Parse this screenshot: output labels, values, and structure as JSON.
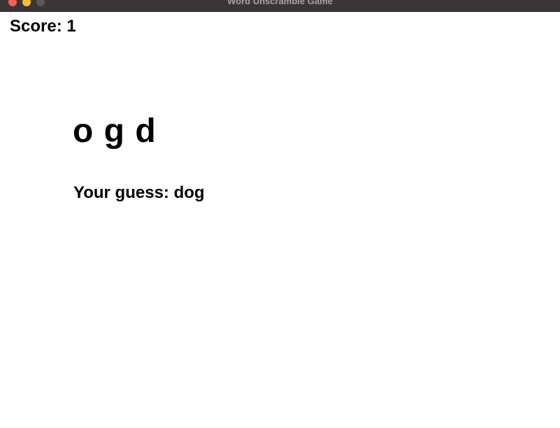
{
  "window": {
    "title": "Word Unscramble Game"
  },
  "game": {
    "score_label": "Score: 1",
    "scrambled_word": "o g d",
    "guess_label": "Your guess: dog"
  },
  "colors": {
    "titlebar": "#3a3536",
    "close": "#fe5f57",
    "minimize": "#febc2e",
    "zoom": "#5a5657",
    "background": "#ffffff",
    "text": "#000000"
  }
}
